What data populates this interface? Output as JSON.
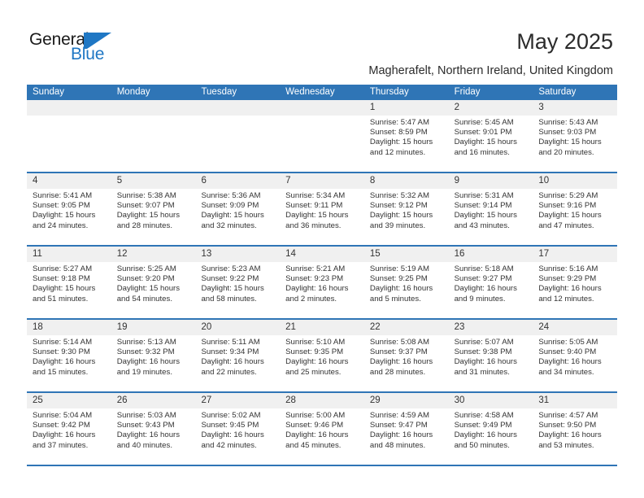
{
  "brand": {
    "name_part1": "General",
    "name_part2": "Blue",
    "logo_icon": "triangle-flag-logo",
    "accent_color": "#1f77c4"
  },
  "header": {
    "title": "May 2025",
    "subtitle": "Magherafelt, Northern Ireland, United Kingdom"
  },
  "theme": {
    "header_blue": "#2f75b6",
    "daynum_band": "#f0f0f0",
    "text": "#333333"
  },
  "calendar": {
    "weekday_headers": [
      "Sunday",
      "Monday",
      "Tuesday",
      "Wednesday",
      "Thursday",
      "Friday",
      "Saturday"
    ],
    "weeks": [
      [
        {
          "day": "",
          "empty": true
        },
        {
          "day": "",
          "empty": true
        },
        {
          "day": "",
          "empty": true
        },
        {
          "day": "",
          "empty": true
        },
        {
          "day": "1",
          "sunrise": "Sunrise: 5:47 AM",
          "sunset": "Sunset: 8:59 PM",
          "daylight_line1": "Daylight: 15 hours",
          "daylight_line2": "and 12 minutes."
        },
        {
          "day": "2",
          "sunrise": "Sunrise: 5:45 AM",
          "sunset": "Sunset: 9:01 PM",
          "daylight_line1": "Daylight: 15 hours",
          "daylight_line2": "and 16 minutes."
        },
        {
          "day": "3",
          "sunrise": "Sunrise: 5:43 AM",
          "sunset": "Sunset: 9:03 PM",
          "daylight_line1": "Daylight: 15 hours",
          "daylight_line2": "and 20 minutes."
        }
      ],
      [
        {
          "day": "4",
          "sunrise": "Sunrise: 5:41 AM",
          "sunset": "Sunset: 9:05 PM",
          "daylight_line1": "Daylight: 15 hours",
          "daylight_line2": "and 24 minutes."
        },
        {
          "day": "5",
          "sunrise": "Sunrise: 5:38 AM",
          "sunset": "Sunset: 9:07 PM",
          "daylight_line1": "Daylight: 15 hours",
          "daylight_line2": "and 28 minutes."
        },
        {
          "day": "6",
          "sunrise": "Sunrise: 5:36 AM",
          "sunset": "Sunset: 9:09 PM",
          "daylight_line1": "Daylight: 15 hours",
          "daylight_line2": "and 32 minutes."
        },
        {
          "day": "7",
          "sunrise": "Sunrise: 5:34 AM",
          "sunset": "Sunset: 9:11 PM",
          "daylight_line1": "Daylight: 15 hours",
          "daylight_line2": "and 36 minutes."
        },
        {
          "day": "8",
          "sunrise": "Sunrise: 5:32 AM",
          "sunset": "Sunset: 9:12 PM",
          "daylight_line1": "Daylight: 15 hours",
          "daylight_line2": "and 39 minutes."
        },
        {
          "day": "9",
          "sunrise": "Sunrise: 5:31 AM",
          "sunset": "Sunset: 9:14 PM",
          "daylight_line1": "Daylight: 15 hours",
          "daylight_line2": "and 43 minutes."
        },
        {
          "day": "10",
          "sunrise": "Sunrise: 5:29 AM",
          "sunset": "Sunset: 9:16 PM",
          "daylight_line1": "Daylight: 15 hours",
          "daylight_line2": "and 47 minutes."
        }
      ],
      [
        {
          "day": "11",
          "sunrise": "Sunrise: 5:27 AM",
          "sunset": "Sunset: 9:18 PM",
          "daylight_line1": "Daylight: 15 hours",
          "daylight_line2": "and 51 minutes."
        },
        {
          "day": "12",
          "sunrise": "Sunrise: 5:25 AM",
          "sunset": "Sunset: 9:20 PM",
          "daylight_line1": "Daylight: 15 hours",
          "daylight_line2": "and 54 minutes."
        },
        {
          "day": "13",
          "sunrise": "Sunrise: 5:23 AM",
          "sunset": "Sunset: 9:22 PM",
          "daylight_line1": "Daylight: 15 hours",
          "daylight_line2": "and 58 minutes."
        },
        {
          "day": "14",
          "sunrise": "Sunrise: 5:21 AM",
          "sunset": "Sunset: 9:23 PM",
          "daylight_line1": "Daylight: 16 hours",
          "daylight_line2": "and 2 minutes."
        },
        {
          "day": "15",
          "sunrise": "Sunrise: 5:19 AM",
          "sunset": "Sunset: 9:25 PM",
          "daylight_line1": "Daylight: 16 hours",
          "daylight_line2": "and 5 minutes."
        },
        {
          "day": "16",
          "sunrise": "Sunrise: 5:18 AM",
          "sunset": "Sunset: 9:27 PM",
          "daylight_line1": "Daylight: 16 hours",
          "daylight_line2": "and 9 minutes."
        },
        {
          "day": "17",
          "sunrise": "Sunrise: 5:16 AM",
          "sunset": "Sunset: 9:29 PM",
          "daylight_line1": "Daylight: 16 hours",
          "daylight_line2": "and 12 minutes."
        }
      ],
      [
        {
          "day": "18",
          "sunrise": "Sunrise: 5:14 AM",
          "sunset": "Sunset: 9:30 PM",
          "daylight_line1": "Daylight: 16 hours",
          "daylight_line2": "and 15 minutes."
        },
        {
          "day": "19",
          "sunrise": "Sunrise: 5:13 AM",
          "sunset": "Sunset: 9:32 PM",
          "daylight_line1": "Daylight: 16 hours",
          "daylight_line2": "and 19 minutes."
        },
        {
          "day": "20",
          "sunrise": "Sunrise: 5:11 AM",
          "sunset": "Sunset: 9:34 PM",
          "daylight_line1": "Daylight: 16 hours",
          "daylight_line2": "and 22 minutes."
        },
        {
          "day": "21",
          "sunrise": "Sunrise: 5:10 AM",
          "sunset": "Sunset: 9:35 PM",
          "daylight_line1": "Daylight: 16 hours",
          "daylight_line2": "and 25 minutes."
        },
        {
          "day": "22",
          "sunrise": "Sunrise: 5:08 AM",
          "sunset": "Sunset: 9:37 PM",
          "daylight_line1": "Daylight: 16 hours",
          "daylight_line2": "and 28 minutes."
        },
        {
          "day": "23",
          "sunrise": "Sunrise: 5:07 AM",
          "sunset": "Sunset: 9:38 PM",
          "daylight_line1": "Daylight: 16 hours",
          "daylight_line2": "and 31 minutes."
        },
        {
          "day": "24",
          "sunrise": "Sunrise: 5:05 AM",
          "sunset": "Sunset: 9:40 PM",
          "daylight_line1": "Daylight: 16 hours",
          "daylight_line2": "and 34 minutes."
        }
      ],
      [
        {
          "day": "25",
          "sunrise": "Sunrise: 5:04 AM",
          "sunset": "Sunset: 9:42 PM",
          "daylight_line1": "Daylight: 16 hours",
          "daylight_line2": "and 37 minutes."
        },
        {
          "day": "26",
          "sunrise": "Sunrise: 5:03 AM",
          "sunset": "Sunset: 9:43 PM",
          "daylight_line1": "Daylight: 16 hours",
          "daylight_line2": "and 40 minutes."
        },
        {
          "day": "27",
          "sunrise": "Sunrise: 5:02 AM",
          "sunset": "Sunset: 9:45 PM",
          "daylight_line1": "Daylight: 16 hours",
          "daylight_line2": "and 42 minutes."
        },
        {
          "day": "28",
          "sunrise": "Sunrise: 5:00 AM",
          "sunset": "Sunset: 9:46 PM",
          "daylight_line1": "Daylight: 16 hours",
          "daylight_line2": "and 45 minutes."
        },
        {
          "day": "29",
          "sunrise": "Sunrise: 4:59 AM",
          "sunset": "Sunset: 9:47 PM",
          "daylight_line1": "Daylight: 16 hours",
          "daylight_line2": "and 48 minutes."
        },
        {
          "day": "30",
          "sunrise": "Sunrise: 4:58 AM",
          "sunset": "Sunset: 9:49 PM",
          "daylight_line1": "Daylight: 16 hours",
          "daylight_line2": "and 50 minutes."
        },
        {
          "day": "31",
          "sunrise": "Sunrise: 4:57 AM",
          "sunset": "Sunset: 9:50 PM",
          "daylight_line1": "Daylight: 16 hours",
          "daylight_line2": "and 53 minutes."
        }
      ]
    ]
  }
}
